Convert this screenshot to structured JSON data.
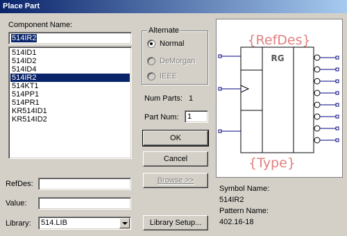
{
  "window": {
    "title": "Place Part"
  },
  "component": {
    "label": "Component Name:",
    "value": "514IR2",
    "items": [
      "514ID1",
      "514ID2",
      "514ID4",
      "514IR2",
      "514KT1",
      "514PP1",
      "514PR1",
      "KR514ID1",
      "KR514ID2"
    ],
    "selected_index": 3
  },
  "alternate": {
    "title": "Alternate",
    "options": [
      {
        "label": "Normal",
        "checked": true,
        "disabled": false
      },
      {
        "label": "DeMorgan",
        "checked": false,
        "disabled": true
      },
      {
        "label": "IEEE",
        "checked": false,
        "disabled": true
      }
    ]
  },
  "parts": {
    "num_label": "Num Parts:",
    "num_value": "1",
    "part_label": "Part Num:",
    "part_value": "1"
  },
  "buttons": {
    "ok": "OK",
    "cancel": "Cancel",
    "browse": "Browse >>",
    "library_setup": "Library Setup..."
  },
  "fields": {
    "refdes_label": "RefDes:",
    "refdes_value": "",
    "value_label": "Value:",
    "value_value": "",
    "library_label": "Library:",
    "library_value": "514.LIB"
  },
  "preview": {
    "refdes_text": "{RefDes}",
    "type_text": "{Type}",
    "center_label": "RG",
    "accent_color": "#e08080",
    "line_color": "#000080"
  },
  "symbol_info": {
    "symbol_name_label": "Symbol Name:",
    "symbol_name_value": "514IR2",
    "pattern_name_label": "Pattern Name:",
    "pattern_name_value": "402.16-18"
  }
}
